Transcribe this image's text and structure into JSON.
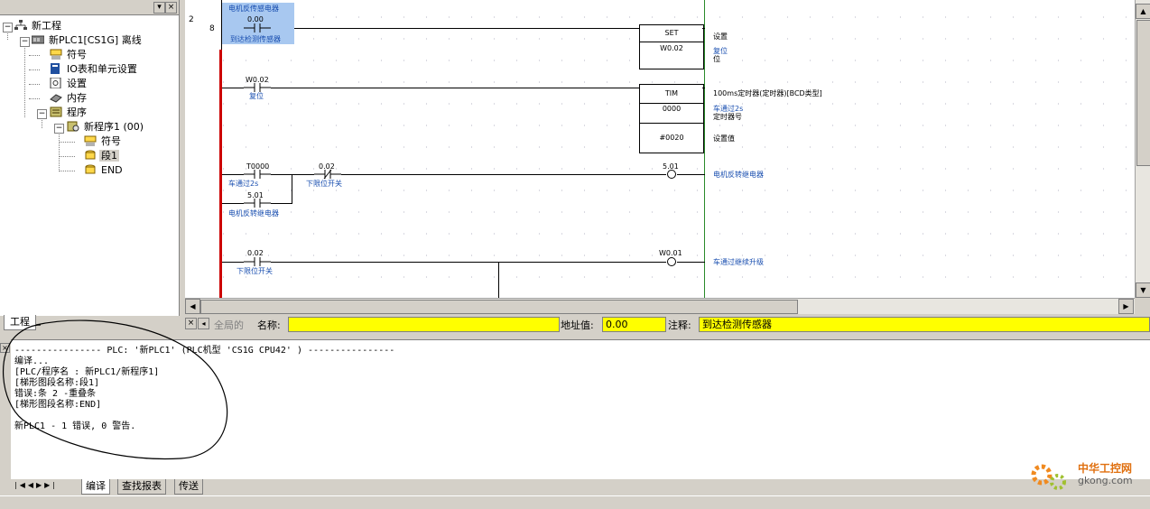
{
  "tree": {
    "items": [
      {
        "label": "新工程",
        "icon": "project-icon"
      },
      {
        "label": "新PLC1[CS1G] 离线",
        "icon": "plc-icon"
      },
      {
        "label": "符号",
        "icon": "symbols-icon"
      },
      {
        "label": "IO表和单元设置",
        "icon": "io-table-icon"
      },
      {
        "label": "设置",
        "icon": "settings-icon"
      },
      {
        "label": "内存",
        "icon": "memory-icon"
      },
      {
        "label": "程序",
        "icon": "programs-icon"
      },
      {
        "label": "新程序1 (00)",
        "icon": "program-icon"
      },
      {
        "label": "符号",
        "icon": "symbols-icon"
      },
      {
        "label": "段1",
        "icon": "section-icon"
      },
      {
        "label": "END",
        "icon": "section-icon"
      }
    ],
    "tab_label": "工程"
  },
  "ladder": {
    "rung_numbers": [
      "2",
      "8"
    ],
    "contact1_name": "电机反传感电器",
    "contact1_addr": "0.00",
    "contact1_comment": "到达检测传感器",
    "set_mnemonic": "SET",
    "set_operand": "W0.02",
    "set_comment": "设置",
    "set_extra1": "复位",
    "set_extra2": "位",
    "contact2_addr": "W0.02",
    "contact2_comment": "复位",
    "tim_mnemonic": "TIM",
    "tim_number": "0000",
    "tim_setvalue": "#0020",
    "tim_desc": "100ms定时器(定时器)[BCD类型]",
    "tim_comment1": "车通过2s",
    "tim_comment2": "定时器号",
    "tim_comment3": "设置值",
    "contact3_addr": "T0000",
    "contact3_comment": "车通过2s",
    "contact4_addr": "0.02",
    "contact4_comment": "下限位开关",
    "coil1_addr": "5.01",
    "coil1_comment": "电机反转继电器",
    "contact5_addr": "5.01",
    "contact5_comment": "电机反转继电器",
    "contact6_addr": "0.02",
    "contact6_comment": "下限位开关",
    "coil2_addr": "W0.01",
    "coil2_comment": "车通过继续升级"
  },
  "infobar": {
    "global_label": "全局的",
    "name_label": "名称:",
    "name_value": "",
    "address_label": "地址值:",
    "address_value": "0.00",
    "comment_label": "注释:",
    "comment_value": "到达检测传感器"
  },
  "output": {
    "lines": [
      "---------------- PLC: '新PLC1' (PLC机型 'CS1G CPU42' ) ----------------",
      "编译...",
      "[PLC/程序名 : 新PLC1/新程序1]",
      "[梯形图段名称:段1]",
      "错误:条 2 -重叠条",
      "[梯形图段名称:END]",
      "",
      "新PLC1 - 1 错误, 0 警告."
    ],
    "tabs": [
      "编译",
      "查找报表",
      "传送"
    ]
  },
  "watermark": {
    "line1": "中华工控网",
    "line2": "gkong.com"
  },
  "colors": {
    "highlight_yellow": "#ffff00",
    "comment_blue": "#1a4fb0",
    "power_rail_red": "#cc0000",
    "annotation_circle": "#000000"
  }
}
